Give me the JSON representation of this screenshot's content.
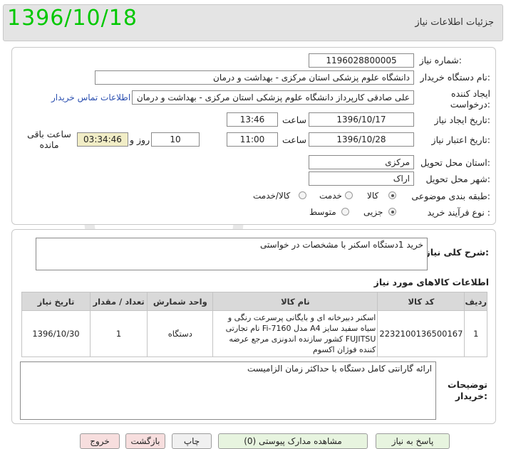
{
  "header": {
    "title": "جزئیات اطلاعات نیاز",
    "date_stamp": "1396/10/18"
  },
  "form": {
    "need_number": {
      "label": "شماره نیاز:",
      "value": "1196028800005"
    },
    "buyer_org": {
      "label": "نام دستگاه خریدار:",
      "value": "دانشگاه علوم پزشکی  استان مرکزی - بهداشت و درمان"
    },
    "requester": {
      "label_line1": "ایجاد کننده",
      "label_line2": "درخواست:",
      "value": "علی صادقی کارپرداز دانشگاه علوم پزشکی  استان مرکزی - بهداشت و درمان",
      "contact_link": "اطلاعات تماس خریدار"
    },
    "created": {
      "label": "تاریخ ایجاد نیاز:",
      "date": "1396/10/17",
      "time_label": "ساعت",
      "time": "13:46"
    },
    "validity": {
      "label": "تاریخ اعتبار نیاز:",
      "date": "1396/10/28",
      "time_label": "ساعت",
      "time": "11:00",
      "days": "10",
      "days_label": "روز و",
      "remaining": "03:34:46",
      "remaining_label": "ساعت باقی مانده"
    },
    "province": {
      "label": "استان محل تحویل:",
      "value": "مرکزی"
    },
    "city": {
      "label": "شهر محل تحویل:",
      "value": "اراک"
    },
    "category": {
      "label": "طبقه بندی موضوعی:",
      "options": [
        "کالا",
        "خدمت",
        "کالا/خدمت"
      ],
      "selected": "کالا"
    },
    "process": {
      "label": "نوع فرآیند خرید :",
      "options": [
        "جزیی",
        "متوسط"
      ],
      "selected": "جزیی"
    }
  },
  "description": {
    "label": "شرح کلی نیاز:",
    "value": "خرید 1دستگاه اسکنر با مشخصات در خواستی"
  },
  "items_section": {
    "title": "اطلاعات کالاهای مورد نیاز",
    "columns": [
      "ردیف",
      "کد کالا",
      "نام کالا",
      "واحد شمارش",
      "تعداد / مقدار",
      "تاریخ نیاز"
    ],
    "rows": [
      {
        "row": "1",
        "code": "2232100136500167",
        "name": "اسکنر دبیرخانه ای و بایگانی پرسرعت رنگی و سیاه سفید سایز A4 مدل Fi-7160 نام تجارتی FUJITSU کشور سازنده اندونزی مرجع عرضه کننده فوژان اکسوم",
        "unit": "دستگاه",
        "qty": "1",
        "date": "1396/10/30"
      }
    ]
  },
  "buyer_notes": {
    "label_line1": "توضیحات",
    "label_line2": "خریدار:",
    "value": "ارائه گارانتی کامل دستگاه با حداکثر زمان الزامیست"
  },
  "buttons": {
    "reply": "پاسخ به نیاز",
    "attachments": "مشاهده مدارک پیوستی (0)",
    "print": "چاپ",
    "back": "بازگشت",
    "exit": "خروج"
  },
  "colors": {
    "date_stamp": "#00c800",
    "link": "#2b4fb0",
    "header_bg": "#e4e4e4",
    "remaining_bg": "#f1edc6"
  }
}
